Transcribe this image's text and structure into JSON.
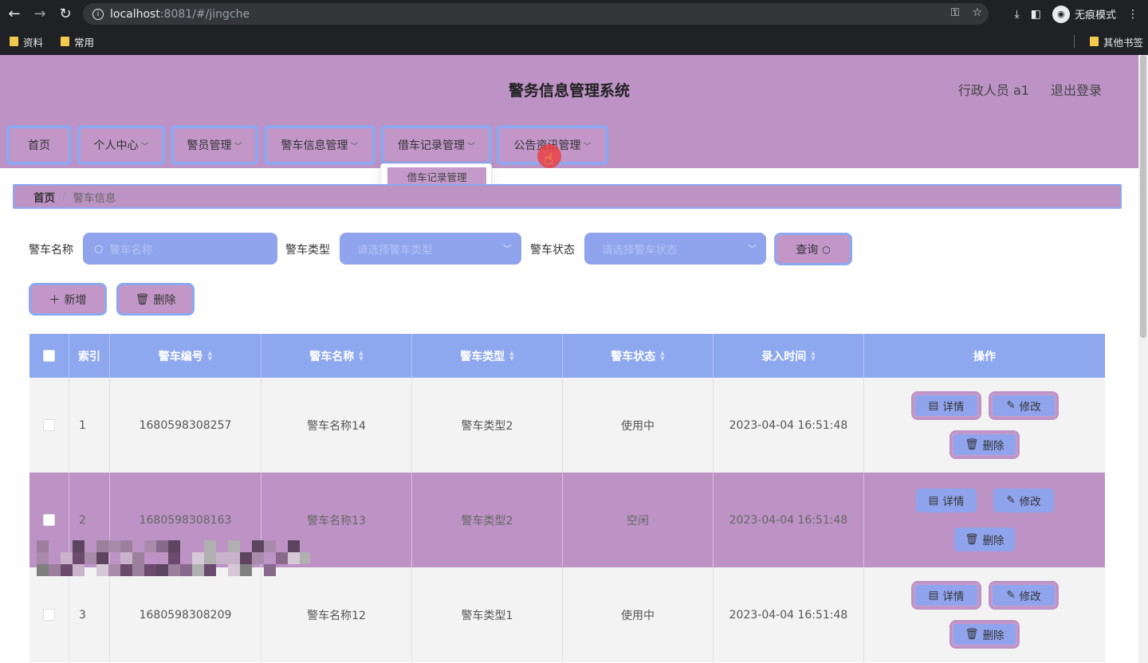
{
  "browser": {
    "url_host": "localhost",
    "url_path": ":8081/#/jingche",
    "profile_label": "无痕模式",
    "bookmarks": [
      "资料",
      "常用"
    ],
    "other_bookmarks": "其他书签"
  },
  "header": {
    "title": "警务信息管理系统",
    "user": "行政人员 a1",
    "logout": "退出登录"
  },
  "menu": [
    {
      "label": "首页"
    },
    {
      "label": "个人中心"
    },
    {
      "label": "警员管理"
    },
    {
      "label": "警车信息管理"
    },
    {
      "label": "借车记录管理"
    },
    {
      "label": "公告资讯管理"
    }
  ],
  "dropdown": {
    "item": "借车记录管理"
  },
  "breadcrumb": {
    "home": "首页",
    "current": "警车信息"
  },
  "search": {
    "name_label": "警车名称",
    "name_placeholder": "警车名称",
    "type_label": "警车类型",
    "type_placeholder": "请选择警车类型",
    "status_label": "警车状态",
    "status_placeholder": "请选择警车状态",
    "query_button": "查询"
  },
  "actions": {
    "add": "新增",
    "delete": "删除"
  },
  "table": {
    "columns": [
      "索引",
      "警车编号",
      "警车名称",
      "警车类型",
      "警车状态",
      "录入时间",
      "操作"
    ],
    "rows": [
      {
        "index": "1",
        "code": "1680598308257",
        "name": "警车名称14",
        "type": "警车类型2",
        "status": "使用中",
        "time": "2023-04-04 16:51:48"
      },
      {
        "index": "2",
        "code": "1680598308163",
        "name": "警车名称13",
        "type": "警车类型2",
        "status": "空闲",
        "time": "2023-04-04 16:51:48"
      },
      {
        "index": "3",
        "code": "1680598308209",
        "name": "警车名称12",
        "type": "警车类型1",
        "status": "使用中",
        "time": "2023-04-04 16:51:48"
      }
    ],
    "ops": {
      "detail": "详情",
      "edit": "修改",
      "delete": "删除"
    }
  },
  "colors": {
    "accent": "#bd93c5",
    "secondary": "#8da8ef"
  }
}
